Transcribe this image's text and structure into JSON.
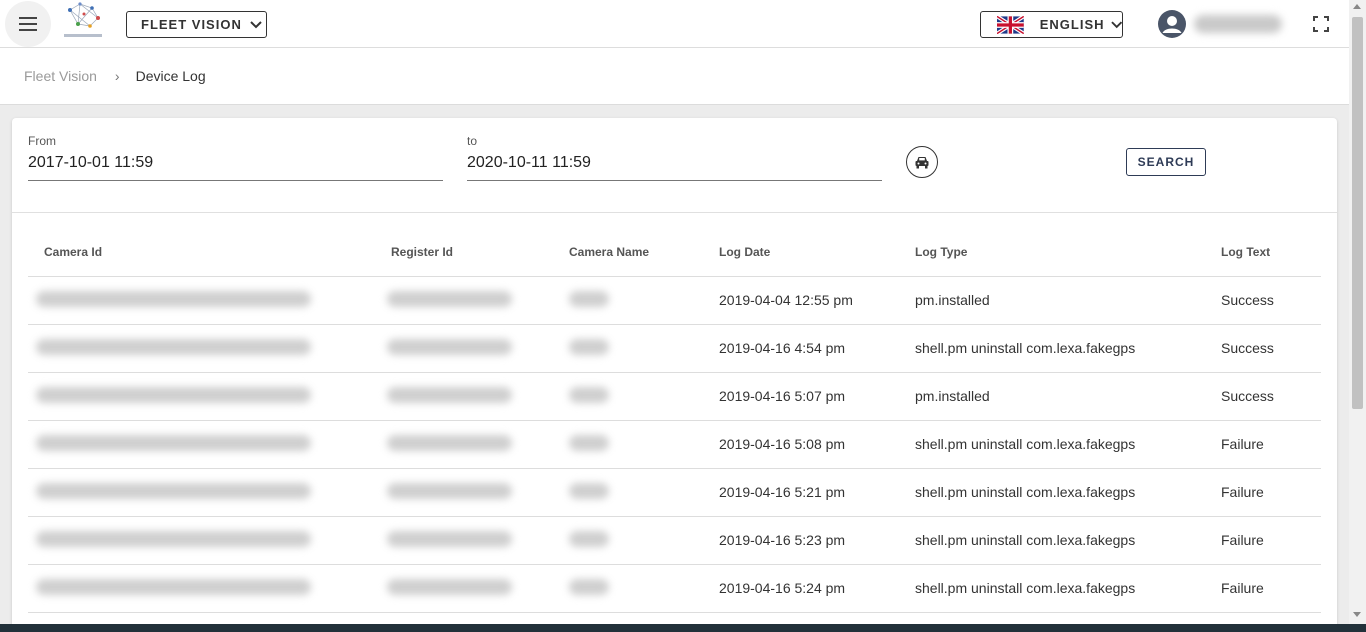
{
  "header": {
    "app_selector": "FLEET VISION",
    "language": "ENGLISH"
  },
  "breadcrumb": {
    "parent": "Fleet Vision",
    "separator": "›",
    "current": "Device Log"
  },
  "filters": {
    "from_label": "From",
    "from_value": "2017-10-01 11:59",
    "to_label": "to",
    "to_value": "2020-10-11 11:59",
    "search_label": "SEARCH"
  },
  "table": {
    "headers": [
      "Camera Id",
      "Register Id",
      "Camera Name",
      "Log Date",
      "Log Type",
      "Log Text"
    ],
    "rows": [
      {
        "log_date": "2019-04-04 12:55 pm",
        "log_type": "pm.installed",
        "log_text": "Success"
      },
      {
        "log_date": "2019-04-16 4:54 pm",
        "log_type": "shell.pm uninstall com.lexa.fakegps",
        "log_text": "Success"
      },
      {
        "log_date": "2019-04-16 5:07 pm",
        "log_type": "pm.installed",
        "log_text": "Success"
      },
      {
        "log_date": "2019-04-16 5:08 pm",
        "log_type": "shell.pm uninstall com.lexa.fakegps",
        "log_text": "Failure"
      },
      {
        "log_date": "2019-04-16 5:21 pm",
        "log_type": "shell.pm uninstall com.lexa.fakegps",
        "log_text": "Failure"
      },
      {
        "log_date": "2019-04-16 5:23 pm",
        "log_type": "shell.pm uninstall com.lexa.fakegps",
        "log_text": "Failure"
      },
      {
        "log_date": "2019-04-16 5:24 pm",
        "log_type": "shell.pm uninstall com.lexa.fakegps",
        "log_text": "Failure"
      }
    ]
  },
  "icons": {
    "menu": "hamburger-menu-icon",
    "logo": "network-logo-icon",
    "flag": "uk-flag-icon",
    "avatar": "user-avatar-icon",
    "fullscreen": "fullscreen-icon",
    "vehicle": "car-icon",
    "chevron": "chevron-down-icon"
  },
  "colors": {
    "accent": "#2e3b56",
    "background": "#ececec",
    "card": "#ffffff",
    "taskbar": "#22313a"
  }
}
